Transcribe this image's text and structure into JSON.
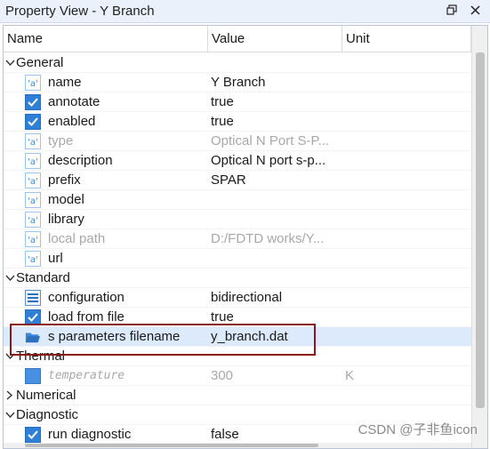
{
  "window": {
    "title": "Property View -  Y Branch"
  },
  "columns": {
    "name": "Name",
    "value": "Value",
    "unit": "Unit"
  },
  "groups": [
    {
      "label": "General",
      "expanded": true,
      "rows": [
        {
          "name": "name",
          "value": " Y Branch",
          "icon": "text-icon",
          "disabled": false
        },
        {
          "name": "annotate",
          "value": "true",
          "icon": "checkbox-icon",
          "disabled": false
        },
        {
          "name": "enabled",
          "value": "true",
          "icon": "checkbox-icon",
          "disabled": false
        },
        {
          "name": "type",
          "value": "Optical N Port S-P...",
          "icon": "text-icon",
          "disabled": true
        },
        {
          "name": "description",
          "value": "Optical N port s-p...",
          "icon": "text-icon",
          "disabled": false
        },
        {
          "name": "prefix",
          "value": "SPAR",
          "icon": "text-icon",
          "disabled": false
        },
        {
          "name": "model",
          "value": "",
          "icon": "text-icon",
          "disabled": false
        },
        {
          "name": "library",
          "value": "",
          "icon": "text-icon",
          "disabled": false
        },
        {
          "name": "local path",
          "value": "D:/FDTD works/Y...",
          "icon": "text-icon",
          "disabled": true
        },
        {
          "name": "url",
          "value": "",
          "icon": "text-icon",
          "disabled": false
        }
      ]
    },
    {
      "label": "Standard",
      "expanded": true,
      "rows": [
        {
          "name": "configuration",
          "value": "bidirectional",
          "icon": "list-icon",
          "disabled": false
        },
        {
          "name": "load from file",
          "value": "true",
          "icon": "checkbox-icon",
          "disabled": false
        },
        {
          "name": "s parameters filename",
          "value": "y_branch.dat",
          "icon": "folder-open-icon",
          "disabled": false,
          "selected": true
        }
      ]
    },
    {
      "label": "Thermal",
      "expanded": true,
      "rows": [
        {
          "name": "temperature",
          "value": "300",
          "unit": "K",
          "icon": "number-icon",
          "disabled": true,
          "italic": true
        }
      ]
    },
    {
      "label": "Numerical",
      "expanded": false,
      "rows": []
    },
    {
      "label": "Diagnostic",
      "expanded": true,
      "rows": [
        {
          "name": "run diagnostic",
          "value": "false",
          "icon": "checkbox-icon",
          "disabled": false
        }
      ]
    }
  ],
  "watermark": "CSDN @子非鱼icon",
  "colors": {
    "accent": "#2f7fd6",
    "selection": "#dceafb",
    "highlight": "#8a1a1a"
  }
}
